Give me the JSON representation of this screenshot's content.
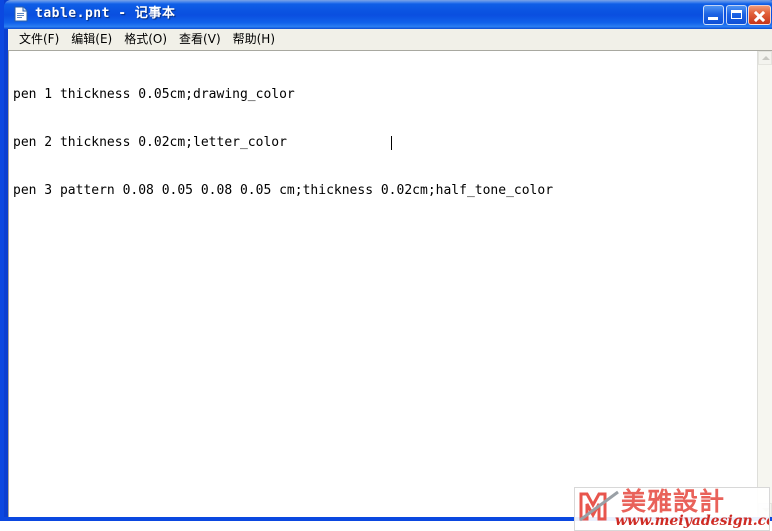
{
  "window": {
    "title": "table.pnt - 记事本",
    "app_icon": "notepad-document-icon",
    "controls": {
      "minimize_label": "最小化",
      "maximize_label": "最大化",
      "close_label": "关闭"
    }
  },
  "menubar": {
    "items": [
      {
        "label": "文件",
        "accel": "F",
        "display": "文件(F)"
      },
      {
        "label": "编辑",
        "accel": "E",
        "display": "编辑(E)"
      },
      {
        "label": "格式",
        "accel": "O",
        "display": "格式(O)"
      },
      {
        "label": "查看",
        "accel": "V",
        "display": "查看(V)"
      },
      {
        "label": "帮助",
        "accel": "H",
        "display": "帮助(H)"
      }
    ]
  },
  "document": {
    "lines": [
      "pen 1 thickness 0.05cm;drawing_color",
      "pen 2 thickness 0.02cm;letter_color",
      "pen 3 pattern 0.08 0.05 0.08 0.05 cm;thickness 0.02cm;half_tone_color"
    ],
    "caret": {
      "line": 3,
      "column": 48
    }
  },
  "scrollbar": {
    "up_icon": "scroll-up-arrow-icon",
    "down_icon": "scroll-down-arrow-icon"
  },
  "watermark": {
    "logo": "meiya-m-logo-icon",
    "chinese_text": "美雅設計",
    "url": "www.meiyadesign.com"
  },
  "colors": {
    "titlebar_blue": "#0b55e2",
    "frame_blue": "#0b48e0",
    "close_red": "#c6351a",
    "menubar_bg": "#f1f0e8",
    "client_bg": "#ffffff",
    "watermark_red": "#e8554d",
    "watermark_url_red": "#cf2b24"
  }
}
